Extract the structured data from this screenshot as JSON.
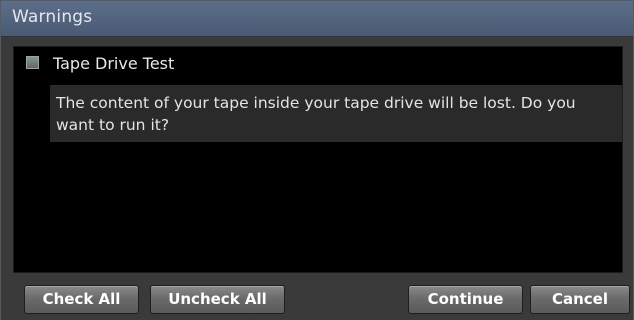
{
  "window": {
    "title": "Warnings"
  },
  "items": [
    {
      "label": "Tape Drive Test",
      "checked": false,
      "description": "The content of your tape inside your tape drive will be lost. Do you want to run it?"
    }
  ],
  "buttons": {
    "check_all": "Check All",
    "uncheck_all": "Uncheck All",
    "continue": "Continue",
    "cancel": "Cancel"
  },
  "colors": {
    "titlebar": "#55667f",
    "panel": "#000000",
    "description_bg": "#2a2a2a",
    "button": "#707070"
  }
}
